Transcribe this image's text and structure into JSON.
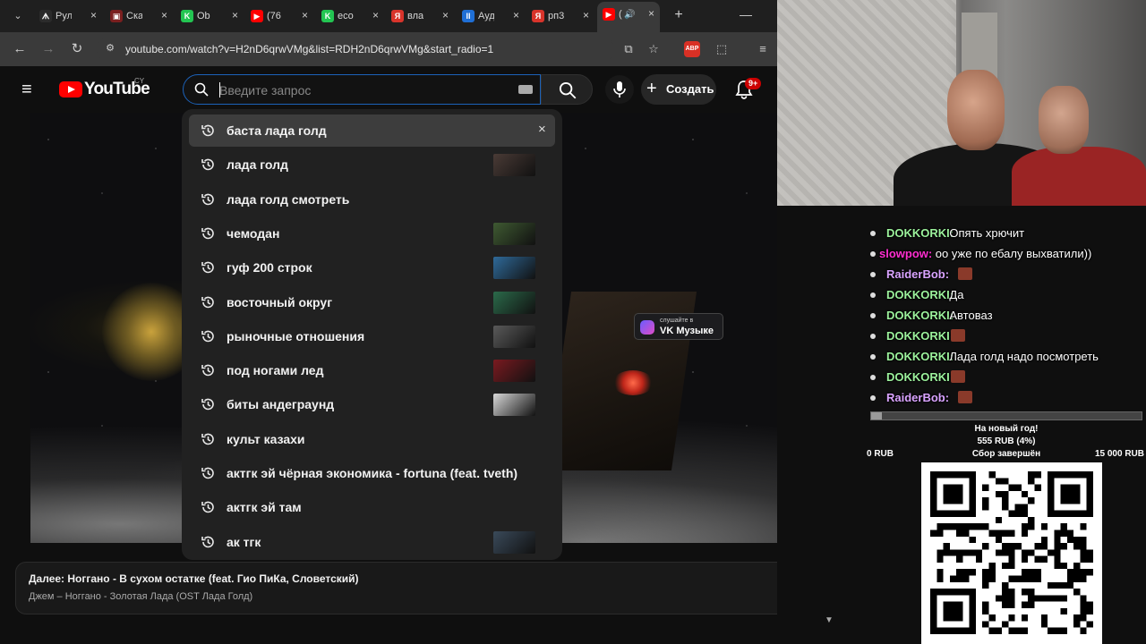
{
  "browser": {
    "tabs": [
      {
        "title": "Рул",
        "fav_color": "#2b2b2b",
        "fav_char": "ᗑ"
      },
      {
        "title": "Ска",
        "fav_color": "#7a1f1f",
        "fav_char": "▣"
      },
      {
        "title": "Ob",
        "fav_color": "#23c552",
        "fav_char": "K"
      },
      {
        "title": "(76",
        "fav_color": "#ff0000",
        "fav_char": "▶"
      },
      {
        "title": "eco",
        "fav_color": "#23c552",
        "fav_char": "K"
      },
      {
        "title": "вла",
        "fav_color": "#d9342b",
        "fav_char": "Я"
      },
      {
        "title": "Ауд",
        "fav_color": "#1f6fd6",
        "fav_char": "II"
      },
      {
        "title": "рп3",
        "fav_color": "#d9342b",
        "fav_char": "Я"
      },
      {
        "title": "(",
        "fav_color": "#ff0000",
        "fav_char": "▶"
      }
    ],
    "url": "youtube.com/watch?v=H2nD6qrwVMg&list=RDH2nD6qrwVMg&start_radio=1",
    "abp_label": "ABP"
  },
  "youtube": {
    "logo_text": "YouTube",
    "country_code": "CY",
    "search_placeholder": "Введите запрос",
    "create_label": "Создать",
    "notif_badge": "9+"
  },
  "suggestions": [
    {
      "text": "баста лада голд",
      "highlighted": true,
      "remove": "×",
      "thumb": null
    },
    {
      "text": "лада голд",
      "thumb": "#4a3b36"
    },
    {
      "text": "лада голд смотреть",
      "thumb": null
    },
    {
      "text": "чемодан",
      "thumb": "#3f5a32"
    },
    {
      "text": "гуф 200 строк",
      "thumb": "#2f6a9a"
    },
    {
      "text": "восточный округ",
      "thumb": "#2b6a4a"
    },
    {
      "text": "рыночные отношения",
      "thumb": "#5a5a5a"
    },
    {
      "text": "под ногами лед",
      "thumb": "#7a1a20"
    },
    {
      "text": "биты андеграунд",
      "thumb": "#d8d8d8"
    },
    {
      "text": "культ казахи",
      "thumb": null
    },
    {
      "text": "актгк эй чёрная экономика - fortuna (feat. tveth)",
      "thumb": null
    },
    {
      "text": "актгк эй там",
      "thumb": null
    },
    {
      "text": "ак тгк",
      "thumb": "#3a4a5a"
    }
  ],
  "video": {
    "vk_line1": "слушайте в",
    "vk_line2": "VK Музыке"
  },
  "up_next": {
    "title": "Далее: Ноггано - В сухом остатке (feat. Гио ПиКа, Словетский)",
    "subtitle": "Джем – Ноггано - Золотая Лада (OST Лада Голд)"
  },
  "chat": [
    {
      "nick": "DOKKORKI:",
      "nick_color": "#9cf29c",
      "msg": "Опять хрючит",
      "emote": false
    },
    {
      "nick": "slowpow:",
      "nick_color": "#ff2fd0",
      "msg": "оо уже по ебалу выхватили))",
      "emote": false
    },
    {
      "nick": "RaiderBob:",
      "nick_color": "#d9a3ff",
      "msg": "",
      "emote": true
    },
    {
      "nick": "DOKKORKI:",
      "nick_color": "#9cf29c",
      "msg": "Да",
      "emote": false
    },
    {
      "nick": "DOKKORKI:",
      "nick_color": "#9cf29c",
      "msg": "Автоваз",
      "emote": false
    },
    {
      "nick": "DOKKORKI:",
      "nick_color": "#9cf29c",
      "msg": "",
      "emote": true
    },
    {
      "nick": "DOKKORKI:",
      "nick_color": "#9cf29c",
      "msg": "Лада голд надо посмотреть",
      "emote": false
    },
    {
      "nick": "DOKKORKI:",
      "nick_color": "#9cf29c",
      "msg": "",
      "emote": true
    },
    {
      "nick": "RaiderBob:",
      "nick_color": "#d9a3ff",
      "msg": "",
      "emote": true
    }
  ],
  "donation_goal": {
    "title": "На новый год!",
    "amount": "555 RUB (4%)",
    "progress_percent": 4,
    "min": "0 RUB",
    "status": "Сбор завершён",
    "max": "15 000 RUB"
  },
  "colors": {
    "yt_red": "#ff0000",
    "search_focus": "#1c62b9",
    "dropdown_bg": "#212121"
  }
}
